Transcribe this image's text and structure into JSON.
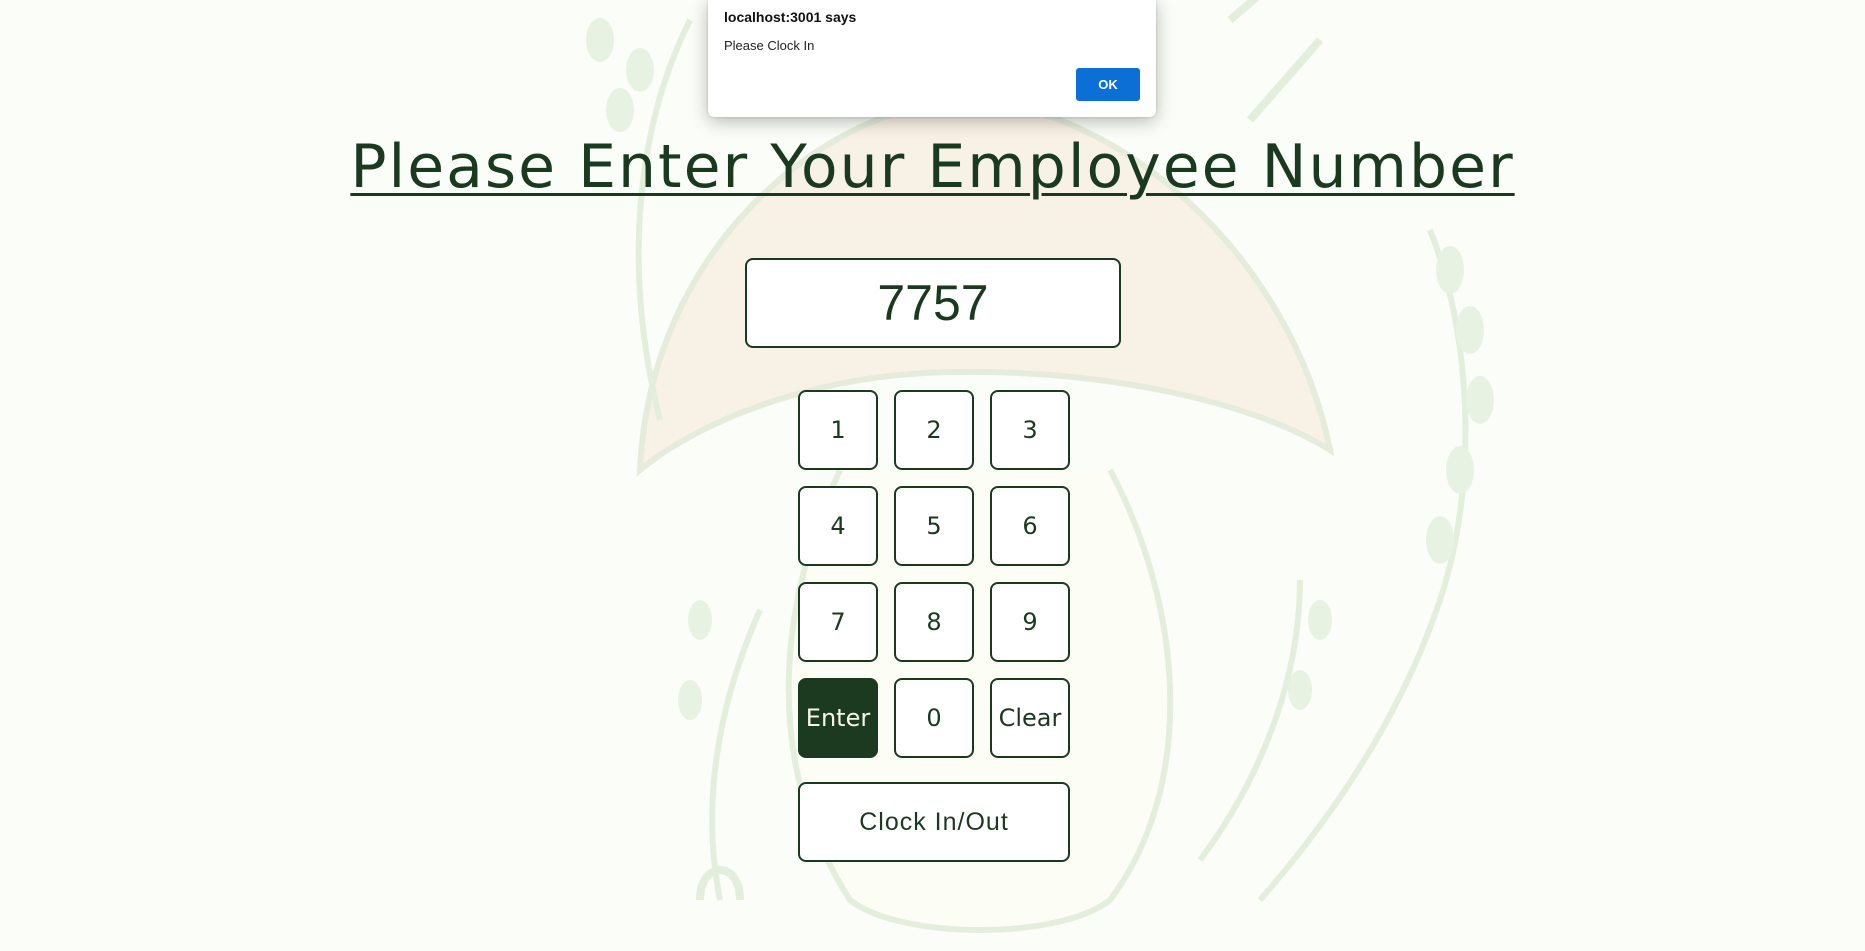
{
  "alert": {
    "origin": "localhost:3001 says",
    "message": "Please Clock In",
    "ok_label": "OK"
  },
  "page": {
    "title": "Please Enter Your Employee Number"
  },
  "display": {
    "value": "7757"
  },
  "keypad": {
    "keys": [
      "1",
      "2",
      "3",
      "4",
      "5",
      "6",
      "7",
      "8",
      "9",
      "Enter",
      "0",
      "Clear"
    ]
  },
  "clock_button": {
    "label": "Clock In/Out"
  },
  "colors": {
    "primary": "#1a3a1f",
    "background": "#fbfdf8",
    "alert_button": "#0b6fd6"
  }
}
